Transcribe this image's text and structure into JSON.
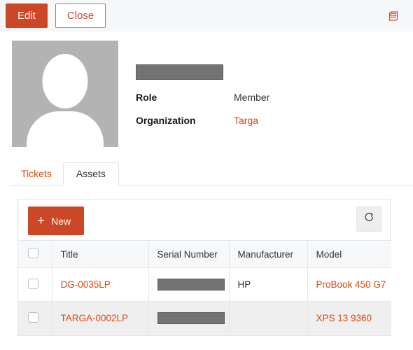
{
  "toolbar": {
    "edit_label": "Edit",
    "close_label": "Close",
    "export_icon": "calculator-icon"
  },
  "profile": {
    "avatar_icon": "person-placeholder-avatar",
    "name_value": "",
    "fields": [
      {
        "label": "Role",
        "value": "Member",
        "is_link": false
      },
      {
        "label": "Organization",
        "value": "Targa",
        "is_link": true
      }
    ]
  },
  "tabs": [
    {
      "label": "Tickets",
      "active": false
    },
    {
      "label": "Assets",
      "active": true
    }
  ],
  "panel": {
    "new_label": "New",
    "plus_glyph": "+",
    "refresh_icon": "refresh-icon"
  },
  "table": {
    "columns": [
      "Title",
      "Serial Number",
      "Manufacturer",
      "Model"
    ],
    "rows": [
      {
        "title": "DG-0035LP",
        "serial": "",
        "manufacturer": "HP",
        "model": "ProBook 450 G7"
      },
      {
        "title": "TARGA-0002LP",
        "serial": "",
        "manufacturer": "",
        "model": "XPS 13 9360"
      }
    ]
  },
  "colors": {
    "accent": "#cc4726",
    "link": "#d9480f",
    "toolbar_bg": "#f6f7f9",
    "border": "#dfe3e8",
    "redaction": "#737373",
    "avatar_bg": "#b3b3b3"
  }
}
